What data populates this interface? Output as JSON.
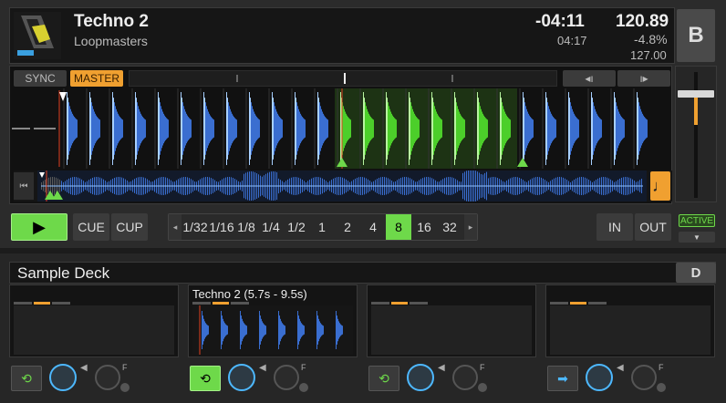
{
  "deck_b": {
    "track_title": "Techno 2",
    "artist": "Loopmasters",
    "time_remaining": "-04:11",
    "time_elapsed": "04:17",
    "bpm": "120.89",
    "pitch": "-4.8%",
    "original_bpm": "127.00",
    "deck_letter": "B",
    "sync_label": "SYNC",
    "master_label": "MASTER",
    "play_icon": "play-icon",
    "cue_label": "CUE",
    "cup_label": "CUP",
    "loop_sizes": [
      "1/32",
      "1/16",
      "1/8",
      "1/4",
      "1/2",
      "1",
      "2",
      "4",
      "8",
      "16",
      "32"
    ],
    "loop_selected": "8",
    "in_label": "IN",
    "out_label": "OUT",
    "active_label": "ACTIVE",
    "note_icon": "music-note-icon"
  },
  "sample_deck": {
    "title": "Sample Deck",
    "deck_letter": "D",
    "slots": [
      {
        "name": "",
        "has_sample": false,
        "button_icon": "loop-icon",
        "button_on": false
      },
      {
        "name": "Techno 2 (5.7s - 9.5s)",
        "has_sample": true,
        "button_icon": "loop-icon",
        "button_on": true
      },
      {
        "name": "",
        "has_sample": false,
        "button_icon": "loop-icon",
        "button_on": false
      },
      {
        "name": "",
        "has_sample": false,
        "button_icon": "arrow-right-icon",
        "button_on": false
      }
    ],
    "fx_label": "F"
  },
  "colors": {
    "accent_green": "#6ed94a",
    "accent_orange": "#f0a030",
    "wave_blue": "#3a6ed0",
    "wave_green": "#4ccf2a"
  }
}
